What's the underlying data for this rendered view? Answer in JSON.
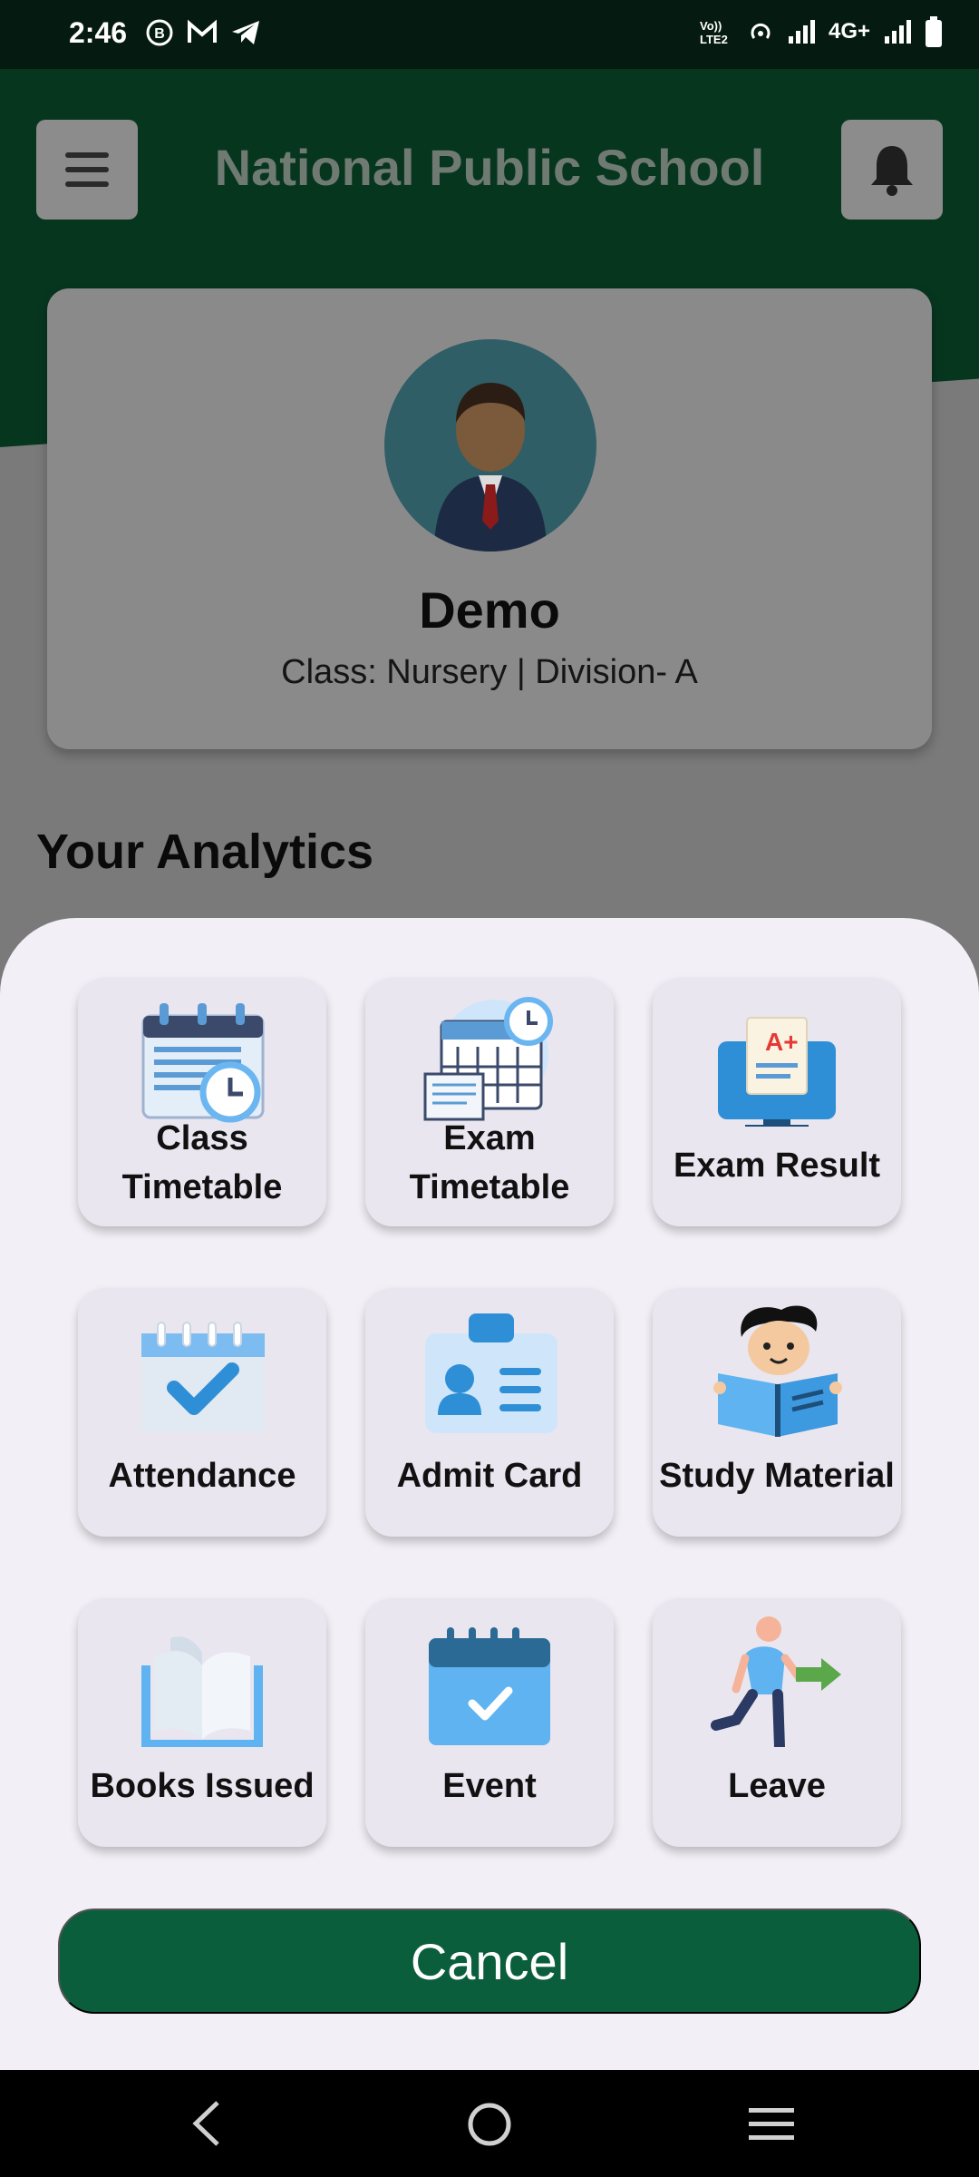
{
  "status_bar": {
    "time": "2:46",
    "left_icons": [
      "b-icon",
      "gmail-icon",
      "telegram-icon"
    ],
    "network": "4G+",
    "right_icons": [
      "volte-icon",
      "hotspot-icon",
      "signal-icon",
      "signal-icon",
      "battery-icon"
    ]
  },
  "header": {
    "title": "National Public School",
    "menu_icon": "hamburger-icon",
    "notification_icon": "bell-icon"
  },
  "profile": {
    "name": "Demo",
    "class_info": "Class: Nursery | Division- A"
  },
  "section_title": "Your Analytics",
  "menu_items": [
    {
      "label": "Class Timetable",
      "icon": "calendar-clock-icon"
    },
    {
      "label": "Exam Timetable",
      "icon": "exam-calendar-icon"
    },
    {
      "label": "Exam Result",
      "icon": "monitor-grade-icon"
    },
    {
      "label": "Attendance",
      "icon": "calendar-check-icon"
    },
    {
      "label": "Admit Card",
      "icon": "id-card-icon"
    },
    {
      "label": "Study Material",
      "icon": "student-reading-icon"
    },
    {
      "label": "Books Issued",
      "icon": "open-book-icon"
    },
    {
      "label": "Event",
      "icon": "event-calendar-icon"
    },
    {
      "label": "Leave",
      "icon": "person-leaving-icon"
    }
  ],
  "menu_labels": {
    "class_timetable": [
      "Class",
      "Timetable"
    ],
    "exam_timetable": [
      "Exam",
      "Timetable"
    ]
  },
  "cancel_label": "Cancel",
  "nav": {
    "back_icon": "back-icon",
    "home_icon": "home-icon",
    "recents_icon": "recents-icon"
  },
  "colors": {
    "primary": "#0b5e3c",
    "header_dark": "#07361f",
    "sheet_bg": "#f3eff6",
    "tile_bg": "#e9e6f0"
  }
}
